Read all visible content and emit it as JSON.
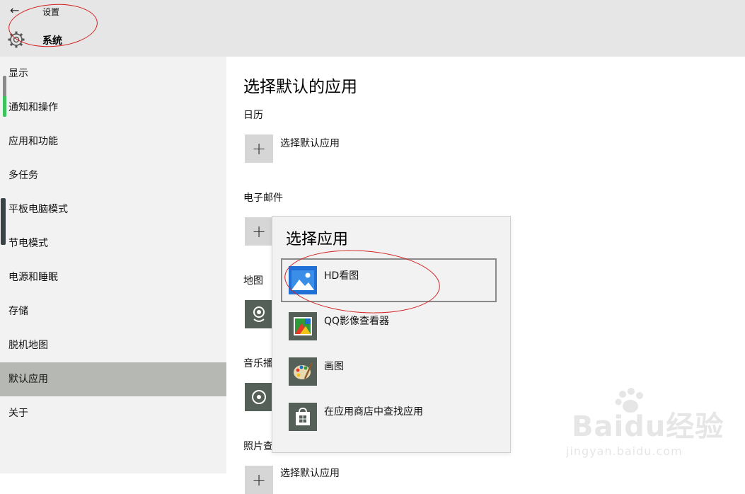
{
  "header": {
    "back_label": "←",
    "title": "设置",
    "section": "系统"
  },
  "sidebar": {
    "items": [
      {
        "label": "显示"
      },
      {
        "label": "通知和操作"
      },
      {
        "label": "应用和功能"
      },
      {
        "label": "多任务"
      },
      {
        "label": "平板电脑模式"
      },
      {
        "label": "节电模式"
      },
      {
        "label": "电源和睡眠"
      },
      {
        "label": "存储"
      },
      {
        "label": "脱机地图"
      },
      {
        "label": "默认应用"
      },
      {
        "label": "关于"
      }
    ],
    "active": "默认应用"
  },
  "main": {
    "title": "选择默认的应用",
    "sections": {
      "calendar": {
        "label": "日历",
        "value": "选择默认应用"
      },
      "email": {
        "label": "电子邮件"
      },
      "maps": {
        "label": "地图"
      },
      "music": {
        "label": "音乐播"
      },
      "photos": {
        "label": "照片查",
        "value": "选择默认应用"
      }
    },
    "plus_symbol": "+"
  },
  "flyout": {
    "title": "选择应用",
    "apps": [
      {
        "label": "HD看图",
        "icon": "photos-icon"
      },
      {
        "label": "QQ影像查看器",
        "icon": "qq-image-viewer-icon"
      },
      {
        "label": "画图",
        "icon": "paint-palette-icon"
      },
      {
        "label": "在应用商店中查找应用",
        "icon": "store-bag-icon"
      }
    ]
  },
  "watermark": {
    "brand": "Baidu经验",
    "url": "jingyan.baidu.com"
  },
  "colors": {
    "header_bg": "#e6e6e6",
    "sidebar_bg": "#f2f2f2",
    "active_item_bg": "#b5b8b3",
    "annotation": "#d32020",
    "tile_dark": "#556059"
  }
}
